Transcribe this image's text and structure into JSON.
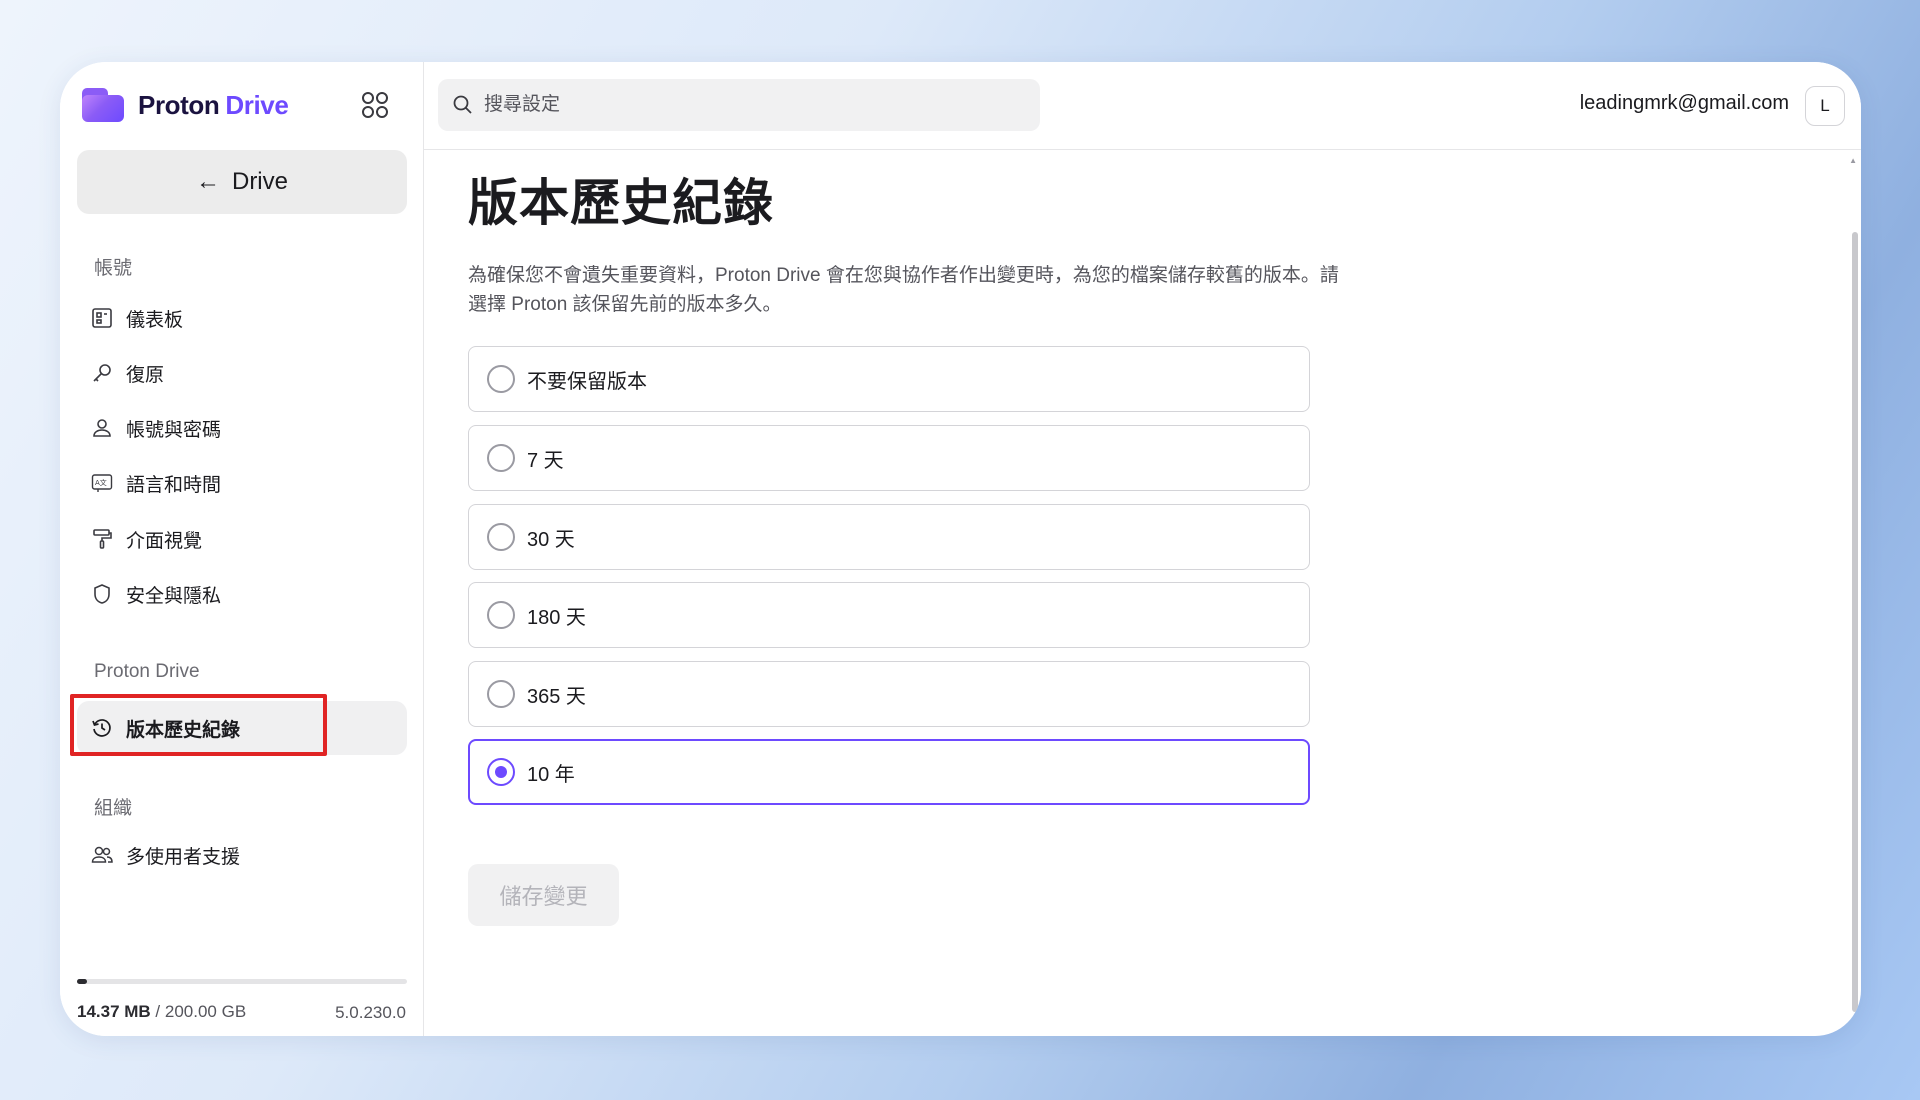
{
  "app": {
    "brand_word1": "Proton",
    "brand_word2": "Drive",
    "accent": "#6d4aff",
    "highlight_color": "#e02424"
  },
  "sidebar": {
    "back_label": "Drive",
    "section_account": "帳號",
    "account_items": [
      {
        "label": "儀表板",
        "icon": "dashboard-icon"
      },
      {
        "label": "復原",
        "icon": "key-icon"
      },
      {
        "label": "帳號與密碼",
        "icon": "user-icon"
      },
      {
        "label": "語言和時間",
        "icon": "language-icon"
      },
      {
        "label": "介面視覺",
        "icon": "paint-roller-icon"
      },
      {
        "label": "安全與隱私",
        "icon": "shield-icon"
      }
    ],
    "section_drive": "Proton Drive",
    "drive_items": [
      {
        "label": "版本歷史紀錄",
        "icon": "history-icon",
        "active": true
      }
    ],
    "section_org": "組織",
    "org_items": [
      {
        "label": "多使用者支援",
        "icon": "users-icon"
      }
    ],
    "storage_used": "14.37 MB",
    "storage_total": " / 200.00 GB",
    "storage_fraction": 0.03,
    "version": "5.0.230.0"
  },
  "topbar": {
    "search_placeholder": "搜尋設定",
    "email": "leadingmrk@gmail.com",
    "avatar_initial": "L"
  },
  "main": {
    "title": "版本歷史紀錄",
    "description": "為確保您不會遺失重要資料，Proton Drive 會在您與協作者作出變更時，為您的檔案儲存較舊的版本。請選擇 Proton 該保留先前的版本多久。",
    "options": [
      {
        "label": "不要保留版本",
        "selected": false
      },
      {
        "label": "7 天",
        "selected": false
      },
      {
        "label": "30 天",
        "selected": false
      },
      {
        "label": "180 天",
        "selected": false
      },
      {
        "label": "365 天",
        "selected": false
      },
      {
        "label": "10 年",
        "selected": true
      }
    ],
    "save_label": "儲存變更"
  }
}
